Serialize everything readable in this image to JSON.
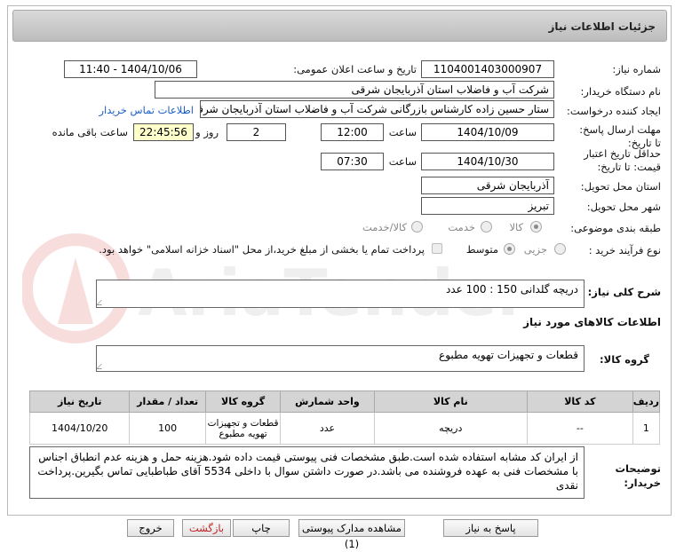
{
  "header": {
    "title": "جزئیات اطلاعات نیاز"
  },
  "fields": {
    "need_number_label": "شماره نیاز:",
    "need_number": "1104001403000907",
    "announce_label": "تاریخ و ساعت اعلان عمومی:",
    "announce_value": "1404/10/06 - 11:40",
    "buyer_org_label": "نام دستگاه خریدار:",
    "buyer_org": "شرکت آب و فاضلاب استان آذربایجان شرقی",
    "requester_label": "ایجاد کننده درخواست:",
    "requester": "ستار حسین زاده کارشناس بازرگانی شرکت آب و فاضلاب استان آذربایجان شرقی",
    "contact_link": "اطلاعات تماس خریدار",
    "send_deadline_label": "مهلت ارسال پاسخ: تا تاریخ:",
    "send_date": "1404/10/09",
    "time_label": "ساعت",
    "send_time": "12:00",
    "days": "2",
    "days_label": "روز و",
    "remaining": "22:45:56",
    "remaining_label": "ساعت باقی مانده",
    "validity_label": "حداقل تاریخ اعتبار قیمت: تا تاریخ:",
    "validity_date": "1404/10/30",
    "validity_time_label": "ساعت",
    "validity_time": "07:30",
    "province_label": "استان محل تحویل:",
    "province": "آذربایجان شرقی",
    "city_label": "شهر محل تحویل:",
    "city": "تبریز",
    "category_label": "طبقه بندی موضوعی:",
    "category_options": [
      "کالا",
      "خدمت",
      "کالا/خدمت"
    ],
    "process_label": "نوع فرآیند خرید :",
    "process_options": [
      "جزیی",
      "متوسط"
    ],
    "payment_note": "پرداخت تمام یا بخشی از مبلغ خرید،از محل \"اسناد خزانه اسلامی\" خواهد بود."
  },
  "description": {
    "label": "شرح کلی نیاز:",
    "value": "دریچه گلدانی 150 : 100 عدد"
  },
  "goods_section": {
    "title": "اطلاعات کالاهای مورد نیاز",
    "group_label": "گروه کالا:",
    "group_value": "قطعات و تجهیزات تهویه مطبوع"
  },
  "table": {
    "headers": [
      "ردیف",
      "کد کالا",
      "نام کالا",
      "واحد شمارش",
      "گروه کالا",
      "تعداد / مقدار",
      "تاریخ نیاز"
    ],
    "rows": [
      [
        "1",
        "--",
        "دریچه",
        "عدد",
        "قطعات و تجهیزات تهویه مطبوع",
        "100",
        "1404/10/20"
      ]
    ]
  },
  "buyer_notes": {
    "label": "توضیحات خریدار:",
    "value": "از ایران کد مشابه استفاده شده است.طبق مشخصات فنی پیوستی قیمت داده شود.هزینه حمل و هزینه عدم انطباق اجناس با مشخصات فنی به عهده فروشنده می باشد.در صورت داشتن سوال با داخلی 5534 آقای طباطبایی تماس بگیرین.پرداخت نقدی"
  },
  "buttons": {
    "reply": "پاسخ به نیاز",
    "attachments": "مشاهده مدارک پیوستی (1)",
    "print": "چاپ",
    "back": "بازگشت",
    "exit": "خروج"
  },
  "watermark": {
    "text": "AriaTender.net"
  },
  "colors": {
    "link": "#1a5fc9",
    "remaining_bg": "#ffffcc",
    "back_text": "#c02020",
    "header_bg": "#c9c9c9"
  }
}
